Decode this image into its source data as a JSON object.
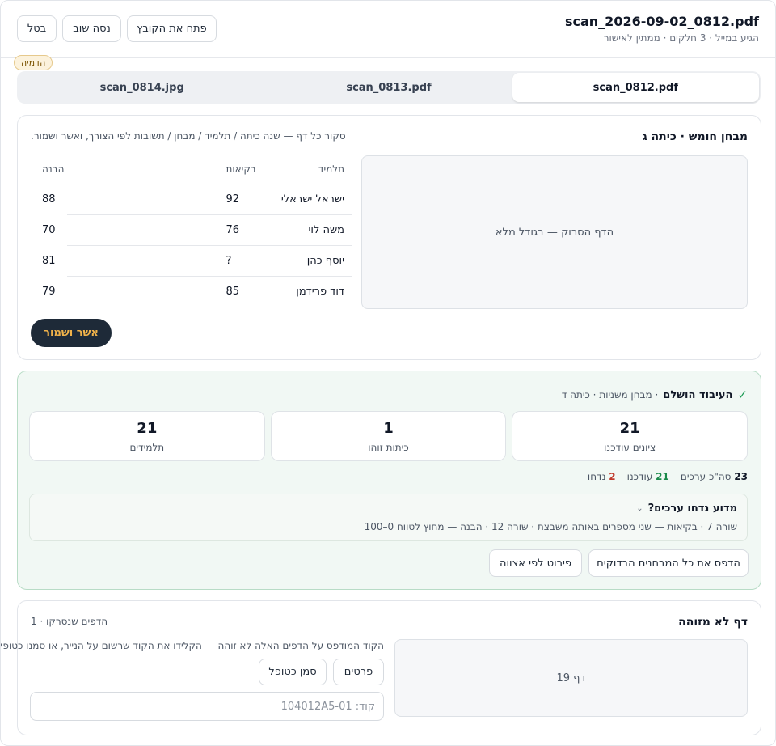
{
  "header": {
    "file_title": "scan_2026-09-02_0812.pdf",
    "file_sub": "הגיע במייל · 3 חלקים · ממתין לאישור",
    "open_file_label": "פתח את הקובץ",
    "retry_label": "נסה שוב",
    "cancel_label": "בטל",
    "demo_badge": "הדמיה"
  },
  "tabs": [
    {
      "label": "scan_0812.pdf",
      "active": true
    },
    {
      "label": "scan_0813.pdf",
      "active": false
    },
    {
      "label": "scan_0814.jpg",
      "active": false
    }
  ],
  "review": {
    "title": "מבחן חומש · כיתה ג",
    "hint": "סקור כל דף — שנה כיתה / תלמיד / מבחן / תשובות לפי הצורך, ואשר ושמור.",
    "preview_label": "הדף הסרוק — בגודל מלא",
    "columns": [
      "תלמיד",
      "בקיאות",
      "הבנה"
    ],
    "rows": [
      {
        "name": "ישראל ישראלי",
        "mastery": "92",
        "comprehension": "88"
      },
      {
        "name": "משה לוי",
        "mastery": "76",
        "comprehension": "70"
      },
      {
        "name": "יוסף כהן",
        "mastery": "?",
        "comprehension": "81"
      },
      {
        "name": "דוד פרידמן",
        "mastery": "85",
        "comprehension": "79"
      }
    ],
    "approve_label": "אשר ושמור"
  },
  "done": {
    "check_icon": "check-icon",
    "title": "העיבוד הושלם",
    "subtitle": "· מבחן משניות · כיתה ד",
    "stats": [
      {
        "num": "21",
        "label": "ציונים עודכנו"
      },
      {
        "num": "1",
        "label": "כיתות זוהו"
      },
      {
        "num": "21",
        "label": "תלמידים"
      }
    ],
    "total_num": "23",
    "total_label": "סה\"כ ערכים",
    "updated_num": "21",
    "updated_label": "עודכנו",
    "rejected_num": "2",
    "rejected_label": "נדחו",
    "why_title": "מדוע נדחו ערכים?",
    "why_line": "שורה 7 · בקיאות — שני מספרים באותה משבצת · שורה 12 · הבנה — מחוץ לטווח 0–100",
    "print_all_label": "הדפס את כל המבחנים הבדוקים",
    "detail_label": "פירוט לפי אצווה"
  },
  "unidentified": {
    "title": "דף לא מזוהה",
    "count": "הדפים שנסרקו · 1",
    "page_label": "דף 19",
    "message": "הקוד המודפס על הדפים האלה לא זוהה — הקלידו את הקוד שרשום על הנייר, או סמנו כטופל.",
    "details_label": "פרטים",
    "mark_handled_label": "סמן כטופל",
    "code_placeholder": "קוד: 104012A5-01"
  },
  "colors": {
    "accent_dark": "#1e2a38",
    "accent_gold": "#f0b24a",
    "success": "#1a9a52",
    "danger": "#c0392b"
  }
}
